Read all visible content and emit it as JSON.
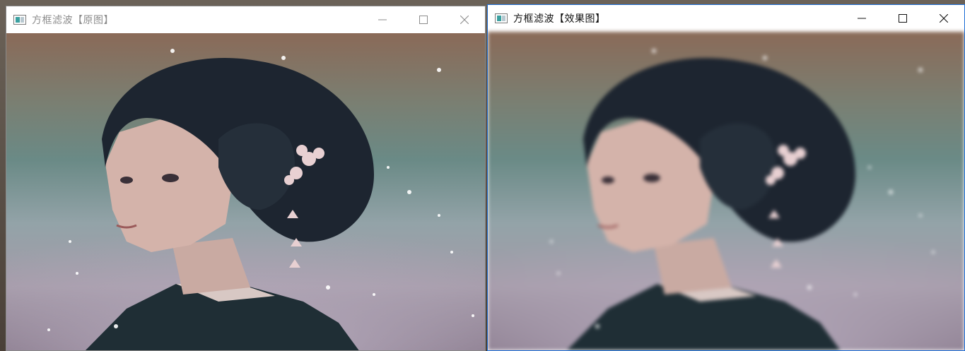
{
  "windows": [
    {
      "title": "方框滤波【原图】",
      "state": "inactive",
      "controls": [
        "minimize-icon",
        "maximize-icon",
        "close-icon"
      ]
    },
    {
      "title": "方框滤波【效果图】",
      "state": "active",
      "controls": [
        "minimize-icon",
        "maximize-icon",
        "close-icon"
      ]
    }
  ],
  "image": {
    "subject": "anime-style girl with dark updo hair, pink flower hairpin, dark kimono, falling snow",
    "left_panel": "original",
    "right_panel": "box-filtered (blurred)"
  },
  "colors": {
    "active_border": "#1f6fd6",
    "inactive_title": "#8c8c8c",
    "active_title": "#111111"
  }
}
